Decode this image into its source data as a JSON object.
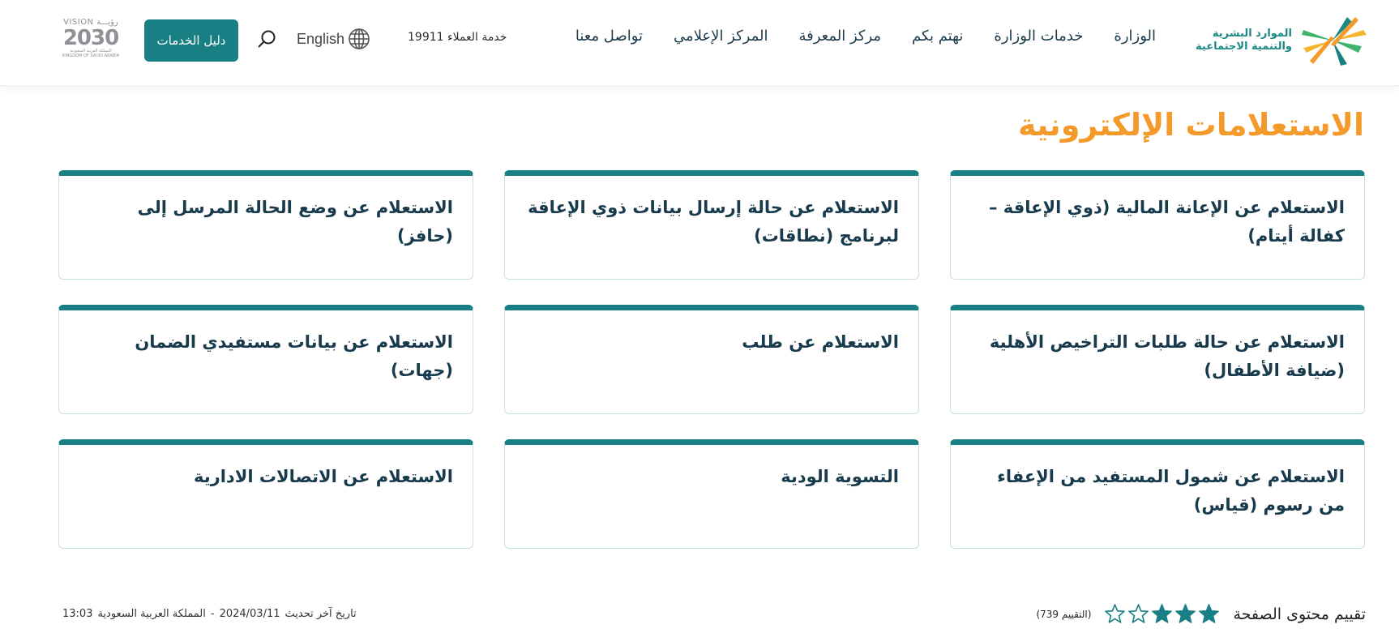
{
  "header": {
    "logo": {
      "line1": "الموارد البشرية",
      "line2": "والتنمية الاجتماعية",
      "icon": "ministry-star-logo"
    },
    "nav": [
      {
        "label": "الوزارة"
      },
      {
        "label": "خدمات الوزارة"
      },
      {
        "label": "نهتم بكم"
      },
      {
        "label": "مركز المعرفة"
      },
      {
        "label": "المركز الإعلامي"
      },
      {
        "label": "تواصل معنا"
      }
    ],
    "customer_service": "خدمة العملاء 19911",
    "language": {
      "label": "English",
      "icon": "globe-icon"
    },
    "search_icon": "search-icon",
    "guide_button": "دليل الخدمات",
    "vision": {
      "top": "VISION رؤيـــة",
      "number": "2030",
      "sub_ar": "المملكة العربية السعودية",
      "sub_en": "KINGDOM OF SAUDI ARABIA"
    }
  },
  "page": {
    "title": "الاستعلامات الإلكترونية",
    "cards": [
      {
        "title": "الاستعلام عن الإعانة المالية (ذوي الإعاقة – كفالة أيتام)"
      },
      {
        "title": "الاستعلام عن حالة إرسال بيانات ذوي الإعاقة لبرنامج (نطاقات)"
      },
      {
        "title": "الاستعلام عن وضع الحالة المرسل إلى (حافز)"
      },
      {
        "title": "الاستعلام عن حالة طلبات التراخيص الأهلية (ضيافة الأطفال)"
      },
      {
        "title": "الاستعلام عن طلب"
      },
      {
        "title": "الاستعلام عن بيانات مستفيدي الضمان (جهات)"
      },
      {
        "title": "الاستعلام عن شمول المستفيد من الإعفاء من رسوم (قياس)"
      },
      {
        "title": "التسوية الودية"
      },
      {
        "title": "الاستعلام عن الاتصالات الادارية"
      }
    ]
  },
  "footer": {
    "rating": {
      "label": "تقييم محتوى الصفحة",
      "value": 3,
      "max": 5,
      "count_text": "(التقييم 739)"
    },
    "last_update": {
      "label": "تاريخ آخر تحديث",
      "date": "2024/03/11",
      "separator": "-",
      "location": "المملكة العربية السعودية",
      "time": "13:03"
    }
  },
  "colors": {
    "accent_teal": "#188084",
    "title_orange": "#f39a2a",
    "text_dark": "#173a4d"
  }
}
